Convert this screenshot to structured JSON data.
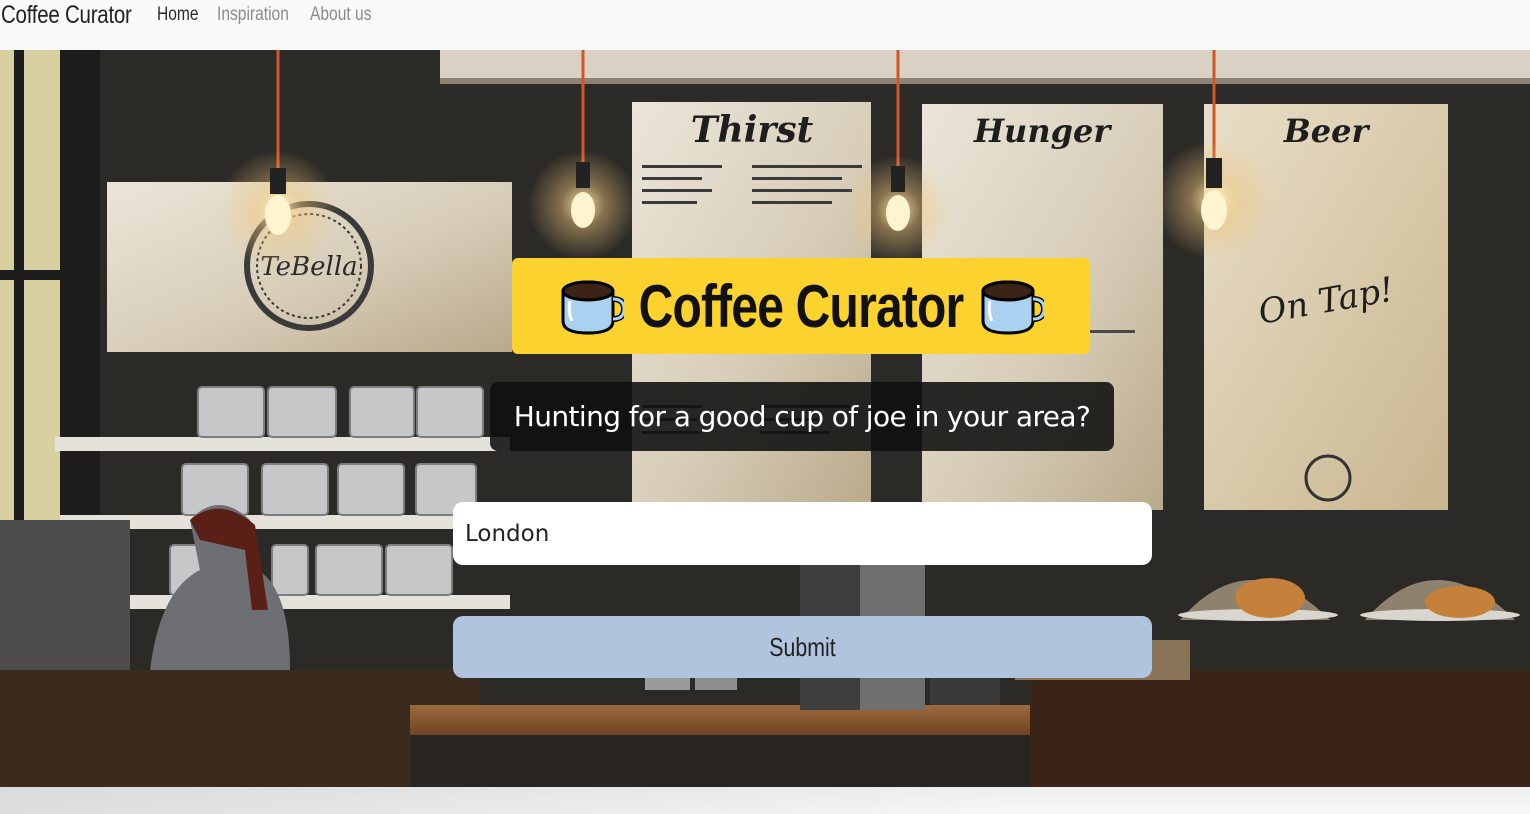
{
  "navbar": {
    "brand": "Coffee Curator",
    "links": [
      {
        "label": "Home",
        "active": true
      },
      {
        "label": "Inspiration",
        "active": false
      },
      {
        "label": "About us",
        "active": false
      }
    ]
  },
  "hero": {
    "title": "Coffee Curator",
    "title_icon": "coffee-mug-icon",
    "tagline": "Hunting for a good cup of joe in your area?",
    "search": {
      "value": "London"
    },
    "submit_label": "Submit",
    "background_signs": {
      "board1_title": "Thirst",
      "board2_title": "Hunger",
      "board3_title": "Beer",
      "board3_tagline": "On Tap!",
      "logo_text": "TeBella"
    }
  },
  "colors": {
    "title_bg": "#fcd22e",
    "submit_bg": "#b0c4de",
    "tagline_bg": "#0f0f0f",
    "navbar_bg": "#f8f9fa"
  }
}
